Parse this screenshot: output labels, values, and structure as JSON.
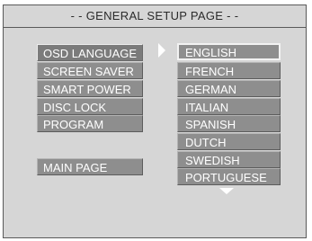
{
  "title": "- - GENERAL SETUP PAGE - -",
  "menu": {
    "items": [
      {
        "label": "OSD LANGUAGE",
        "selected": true
      },
      {
        "label": "SCREEN SAVER",
        "selected": false
      },
      {
        "label": "SMART POWER",
        "selected": false
      },
      {
        "label": "DISC LOCK",
        "selected": false
      },
      {
        "label": "PROGRAM",
        "selected": false
      }
    ],
    "main_page": "MAIN PAGE"
  },
  "options": {
    "items": [
      {
        "label": "ENGLISH",
        "selected": true
      },
      {
        "label": "FRENCH",
        "selected": false
      },
      {
        "label": "GERMAN",
        "selected": false
      },
      {
        "label": "ITALIAN",
        "selected": false
      },
      {
        "label": "SPANISH",
        "selected": false
      },
      {
        "label": "DUTCH",
        "selected": false
      },
      {
        "label": "SWEDISH",
        "selected": false
      },
      {
        "label": "PORTUGUESE",
        "selected": false
      }
    ],
    "more_indicator": "triangle-down-icon"
  },
  "colors": {
    "screen_background": "#d6d6d6",
    "item_background": "#8e8e8e",
    "selected_item_background": "#7b7b7b",
    "item_text": "#ffffff",
    "title_text": "#2b2b2b"
  }
}
